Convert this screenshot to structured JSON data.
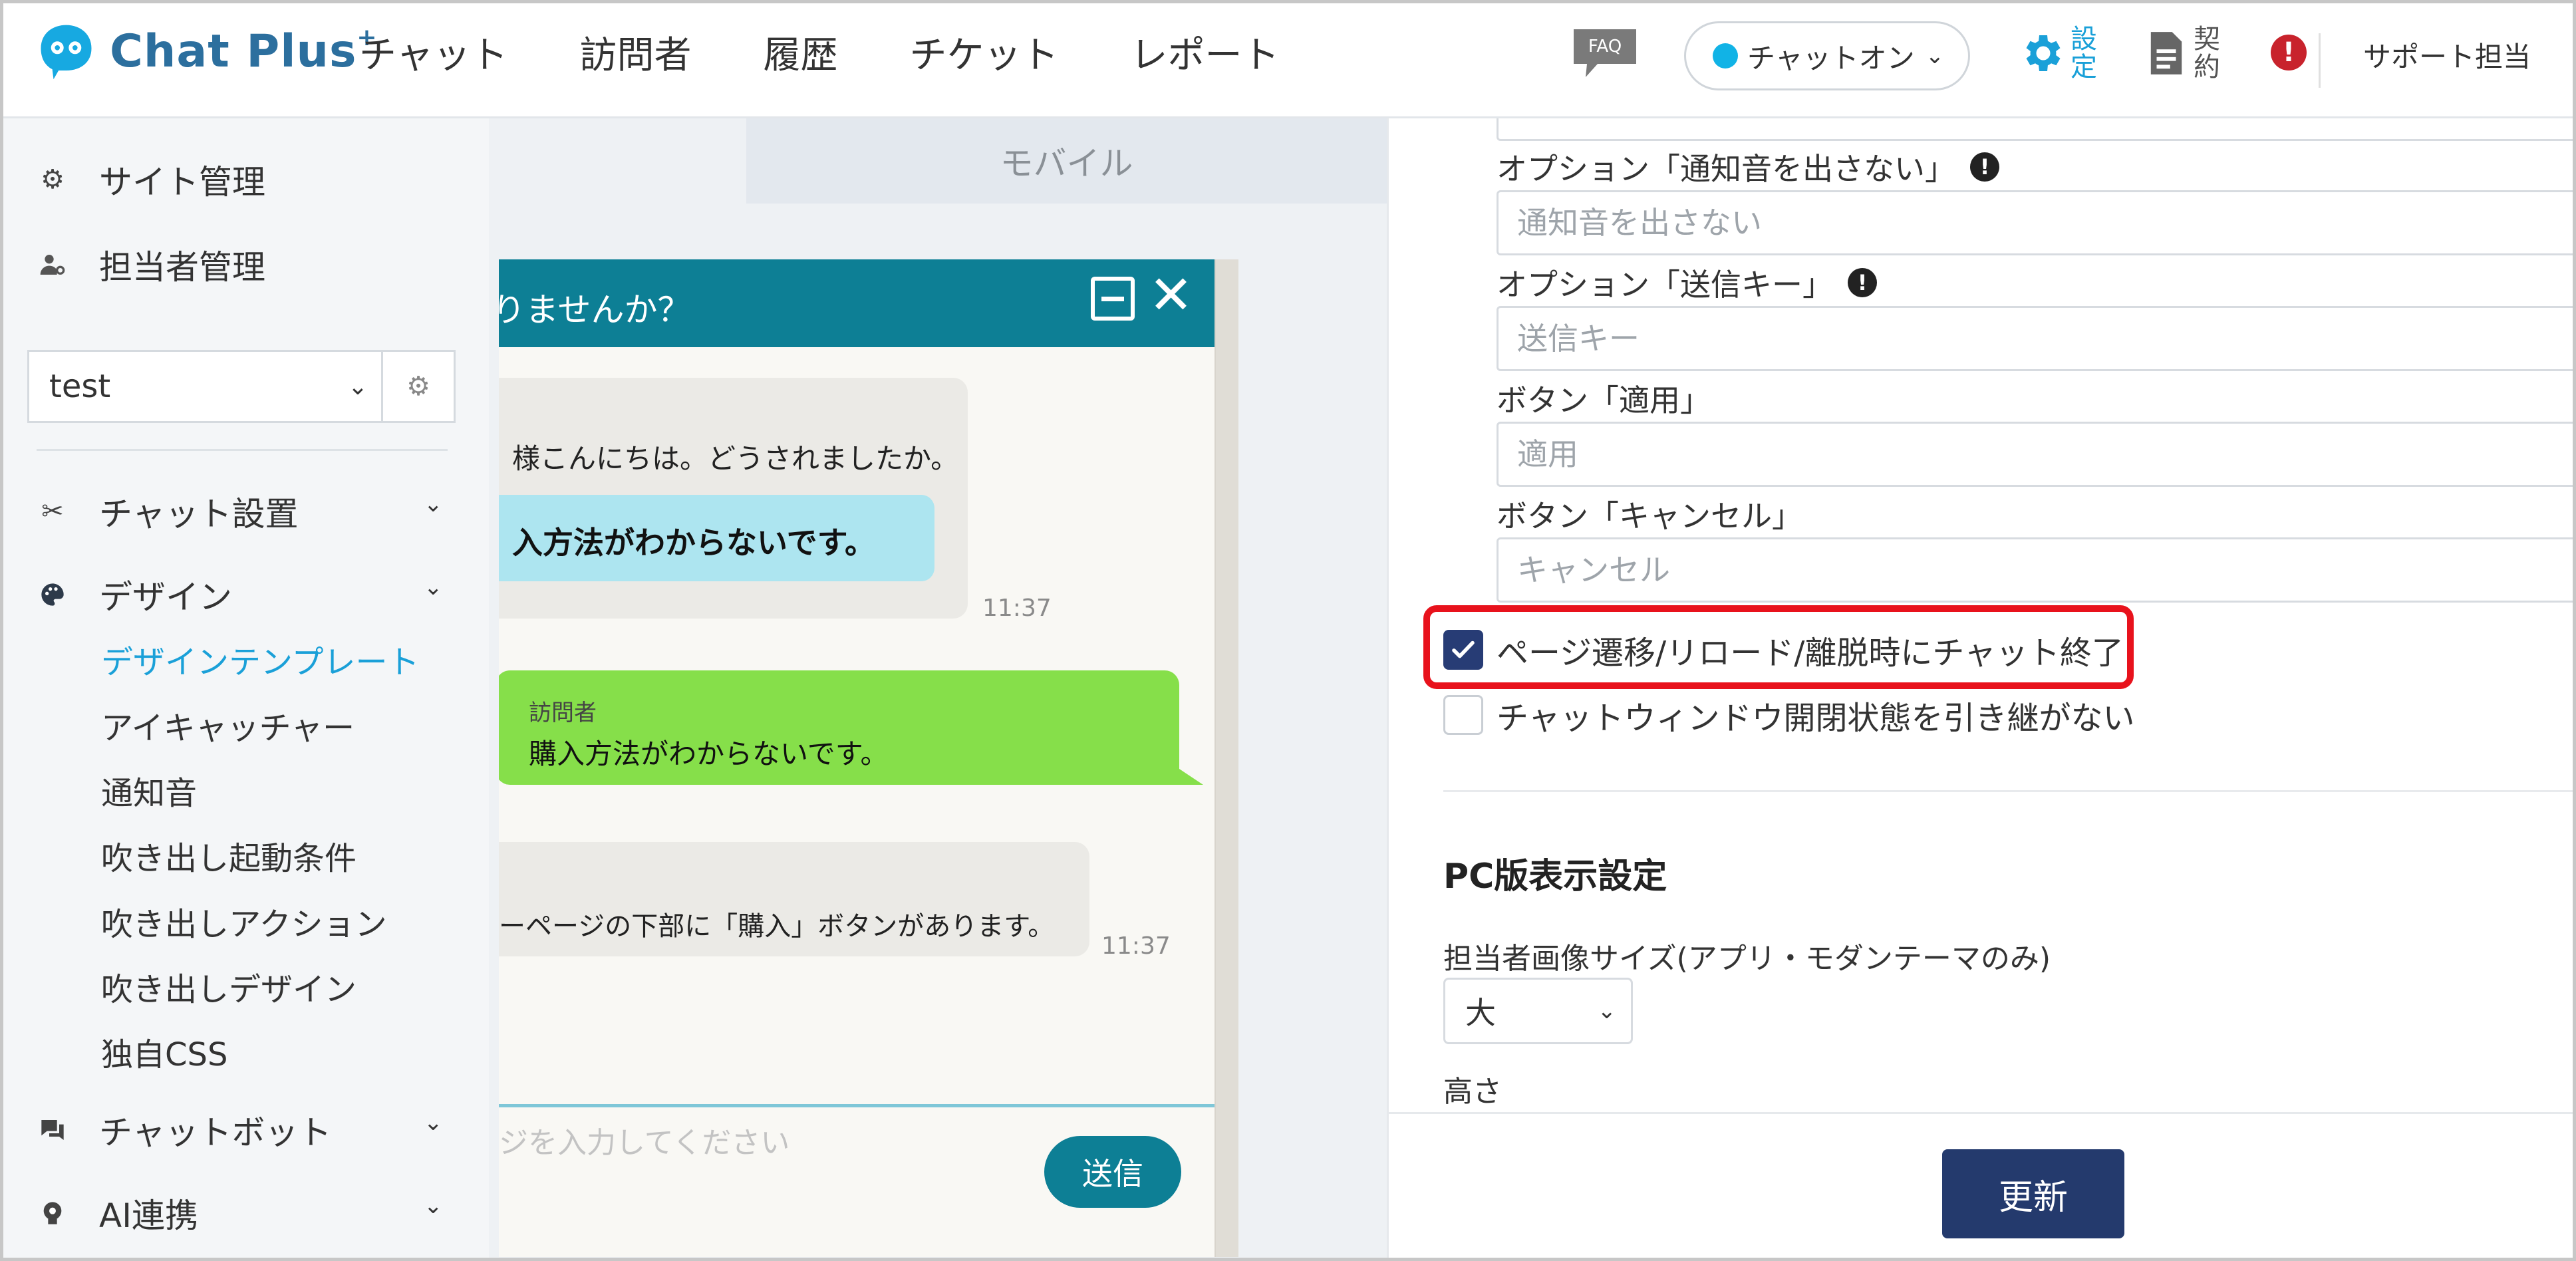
{
  "brand": {
    "logo_text": "Chat Plus",
    "logo_sup": "+"
  },
  "nav": [
    "チャット",
    "訪問者",
    "履歴",
    "チケット",
    "レポート"
  ],
  "header": {
    "faq_label": "FAQ",
    "status_label": "チャットオン",
    "settings_label": "設定",
    "contract_label": "契約",
    "user_name": "サポート担当",
    "status_color": "#11b3e6",
    "alert_color": "#c8232c"
  },
  "sidebar": {
    "site_management": "サイト管理",
    "agent_management": "担当者管理",
    "site_select_value": "test",
    "sections": {
      "chat_setup": "チャット設置",
      "design": "デザイン",
      "chatbot": "チャットボット",
      "ai": "AI連携"
    },
    "design_sub": [
      "デザインテンプレート",
      "アイキャッチャー",
      "通知音",
      "吹き出し起動条件",
      "吹き出しアクション",
      "吹き出しデザイン",
      "独自CSS"
    ],
    "active_color": "#1aa0d8"
  },
  "preview": {
    "tab_label": "モバイル",
    "chat_title": "りませんか？",
    "operator_greeting": "様こんにちは。どうされましたか。",
    "operator_quote": "入方法がわからないです。",
    "time1": "11:37",
    "visitor_label": "訪問者",
    "visitor_message": "購入方法がわからないです。",
    "operator_reply": "ーページの下部に「購入」ボタンがあります。",
    "time2": "11:37",
    "input_placeholder": "ジを入力してください",
    "send_label": "送信",
    "header_color": "#0d7f95",
    "visitor_color": "#86df4a",
    "quote_color": "#ade5f0"
  },
  "settings": {
    "fields": [
      {
        "label": "オプション「通知音を出さない」",
        "placeholder": "通知音を出さない",
        "info": true
      },
      {
        "label": "オプション「送信キー」",
        "placeholder": "送信キー",
        "info": true
      },
      {
        "label": "ボタン「適用」",
        "placeholder": "適用",
        "info": false
      },
      {
        "label": "ボタン「キャンセル」",
        "placeholder": "キャンセル",
        "info": false
      }
    ],
    "checkbox_end_chat": {
      "label": "ページ遷移/リロード/離脱時にチャット終了",
      "checked": true
    },
    "checkbox_no_inherit": {
      "label": "チャットウィンドウ開閉状態を引き継がない",
      "checked": false
    },
    "pc_section_title": "PC版表示設定",
    "agent_image_size_label": "担当者画像サイズ(アプリ・モダンテーマのみ)",
    "agent_image_size_value": "大",
    "height_label": "高さ",
    "update_label": "更新",
    "highlight_color": "#e8121c",
    "update_color": "#243a6d"
  }
}
